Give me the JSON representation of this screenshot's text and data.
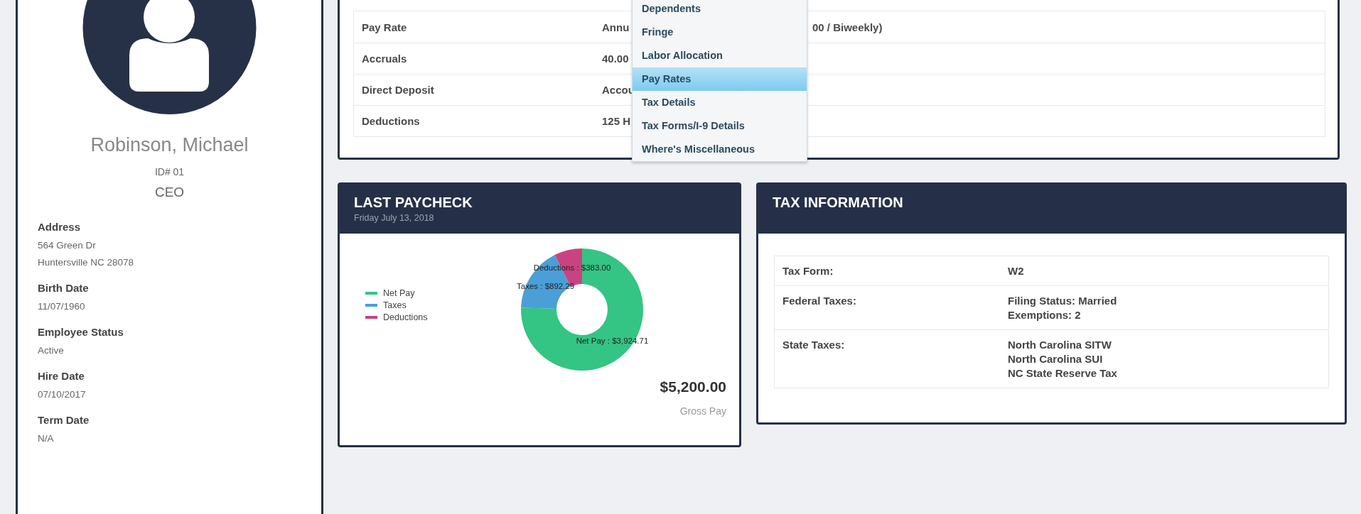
{
  "profile": {
    "name": "Robinson, Michael",
    "id": "ID# 01",
    "title": "CEO",
    "fields": [
      {
        "label": "Address",
        "lines": [
          "564 Green Dr",
          "Huntersville NC 28078"
        ]
      },
      {
        "label": "Birth Date",
        "lines": [
          "11/07/1960"
        ]
      },
      {
        "label": "Employee Status",
        "lines": [
          "Active"
        ]
      },
      {
        "label": "Hire Date",
        "lines": [
          "07/10/2017"
        ]
      },
      {
        "label": "Term Date",
        "lines": [
          "N/A"
        ]
      }
    ]
  },
  "summary_table": {
    "rows": [
      {
        "label": "Pay Rate",
        "value": "Annu",
        "value_tail": "00 / Biweekly)"
      },
      {
        "label": "Accruals",
        "value": "40.00"
      },
      {
        "label": "Direct Deposit",
        "value": "Accou"
      },
      {
        "label": "Deductions",
        "value": "125 H"
      }
    ]
  },
  "context_menu": {
    "items": [
      {
        "label": "Dependents",
        "selected": false
      },
      {
        "label": "Fringe",
        "selected": false
      },
      {
        "label": "Labor Allocation",
        "selected": false
      },
      {
        "label": "Pay Rates",
        "selected": true
      },
      {
        "label": "Tax Details",
        "selected": false
      },
      {
        "label": "Tax Forms/I-9 Details",
        "selected": false
      },
      {
        "label": "Where's Miscellaneous",
        "selected": false
      }
    ]
  },
  "last_paycheck": {
    "title": "LAST PAYCHECK",
    "date": "Friday July 13, 2018",
    "chart_data": {
      "type": "donut",
      "legend": "left",
      "categories": [
        "Net Pay",
        "Taxes",
        "Deductions"
      ],
      "values": [
        3924.71,
        892.29,
        383.0
      ],
      "colors": [
        "#34c483",
        "#4a9fd6",
        "#c8437f"
      ],
      "value_labels": [
        "Net Pay : $3,924.71",
        "Taxes : $892.29",
        "Deductions : $383.00"
      ]
    },
    "gross_amount": "$5,200.00",
    "gross_label": "Gross Pay"
  },
  "tax_information": {
    "title": "TAX INFORMATION",
    "rows": [
      {
        "label": "Tax Form:",
        "lines": [
          "W2"
        ]
      },
      {
        "label": "Federal Taxes:",
        "lines": [
          "Filing Status: Married",
          "Exemptions: 2"
        ]
      },
      {
        "label": "State Taxes:",
        "lines": [
          "North Carolina SITW",
          "North Carolina SUI",
          "NC State Reserve Tax"
        ]
      }
    ]
  }
}
